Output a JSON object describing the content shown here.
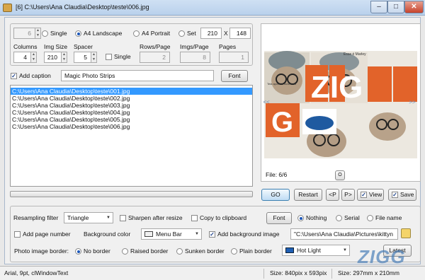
{
  "window": {
    "title": "[6] C:\\Users\\Ana Claudia\\Desktop\\teste\\006.jpg",
    "min_label": "–",
    "max_label": "□",
    "close_label": "✕"
  },
  "layout_panel": {
    "count_value": "6",
    "radio_single": "Single",
    "radio_a4_landscape": "A4 Landscape",
    "radio_a4_portrait": "A4 Portrait",
    "radio_set": "Set",
    "set_width": "210",
    "set_x": "X",
    "set_height": "148",
    "columns_label": "Columns",
    "columns_value": "4",
    "img_size_label": "Img Size",
    "img_size_value": "210",
    "spacer_label": "Spacer",
    "spacer_value": "5",
    "single_checkbox": "Single",
    "rows_page_label": "Rows/Page",
    "rows_page_value": "2",
    "imgs_page_label": "Imgs/Page",
    "imgs_page_value": "8",
    "pages_label": "Pages",
    "pages_value": "1"
  },
  "caption": {
    "checkbox_label": "Add caption",
    "value": "Magic Photo Strips",
    "font_button": "Font"
  },
  "files": [
    "C:\\Users\\Ana Claudia\\Desktop\\teste\\001.jpg",
    "C:\\Users\\Ana Claudia\\Desktop\\teste\\002.jpg",
    "C:\\Users\\Ana Claudia\\Desktop\\teste\\003.jpg",
    "C:\\Users\\Ana Claudia\\Desktop\\teste\\004.jpg",
    "C:\\Users\\Ana Claudia\\Desktop\\teste\\005.jpg",
    "C:\\Users\\Ana Claudia\\Desktop\\teste\\006.jpg"
  ],
  "preview": {
    "file_label": "File: 6/6",
    "prev_arrow": "<<",
    "next_arrow": ">>",
    "center_button": "O",
    "overlay_text_left": "Esse é Marley",
    "overlay_text_small": "Tela após de download",
    "zig_text": "ZIG",
    "g_text": "G"
  },
  "actions": {
    "go": "GO",
    "restart": "Restart",
    "prev": "<P",
    "next": "P>",
    "view_label": "View",
    "save_label": "Save"
  },
  "options": {
    "resampling_label": "Resampling filter",
    "resampling_value": "Triangle",
    "sharpen_label": "Sharpen after resize",
    "copy_clipboard_label": "Copy to clipboard",
    "font_button": "Font",
    "radio_nothing": "Nothing",
    "radio_serial": "Serial",
    "radio_file_name": "File name",
    "add_page_number_label": "Add page number",
    "bg_color_label": "Background color",
    "bg_color_value": "Menu Bar",
    "add_bg_image_label": "Add background image",
    "bg_image_path": "\"C:\\Users\\Ana Claudia\\Pictures\\kittyn",
    "border_label": "Photo image border:",
    "radio_no_border": "No border",
    "radio_raised": "Raised border",
    "radio_sunken": "Sunken border",
    "radio_plain": "Plain border",
    "border_color_value": "Hot Light",
    "latest_button": "Latest"
  },
  "status": {
    "font_info": "Arial, 9pt, clWindowText",
    "pixel_size": "Size: 840pix x 593pix",
    "mm_size": "Size: 297mm x 210mm"
  },
  "watermark": "ZIGG",
  "colors": {
    "accent": "#3399ff",
    "zig_orange": "#e2632a",
    "watermark_blue": "#3f78b5"
  }
}
